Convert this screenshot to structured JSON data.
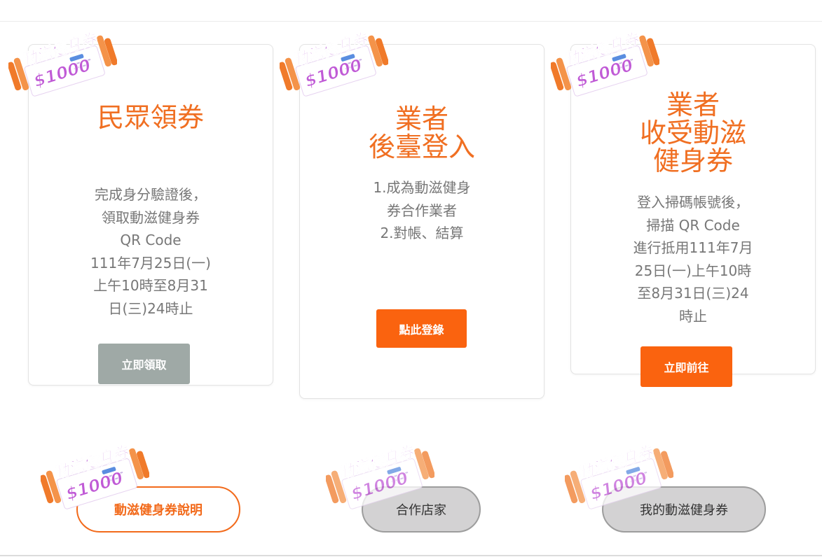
{
  "logo": {
    "name": "動滋健身券",
    "amount": "$1000"
  },
  "cards": [
    {
      "title": [
        "民眾領券"
      ],
      "description": [
        "完成身分驗證後，",
        "領取動滋健身券",
        "QR Code",
        "111年7月25日(一)",
        "上午10時至8月31",
        "日(三)24時止"
      ],
      "button": "立即領取"
    },
    {
      "title": [
        "業者",
        "後臺登入"
      ],
      "description": [
        "1.成為動滋健身",
        "券合作業者",
        "2.對帳、結算"
      ],
      "button": "點此登錄"
    },
    {
      "title": [
        "業者",
        "收受動滋",
        "健身券"
      ],
      "description": [
        "登入掃碼帳號後，",
        "掃描 QR Code",
        "進行抵用111年7月",
        "25日(一)上午10時",
        "至8月31日(三)24",
        "時止"
      ],
      "button": "立即前往"
    }
  ],
  "links": [
    {
      "label": "動滋健身券說明"
    },
    {
      "label": "合作店家"
    },
    {
      "label": "我的動滋健身券"
    }
  ],
  "colors": {
    "accent": "#f06f22",
    "button_orange": "#fa630f",
    "button_gray": "#9fa9a6",
    "logo_purple": "#b24fd0",
    "logo_orange": "#f07a2a"
  }
}
